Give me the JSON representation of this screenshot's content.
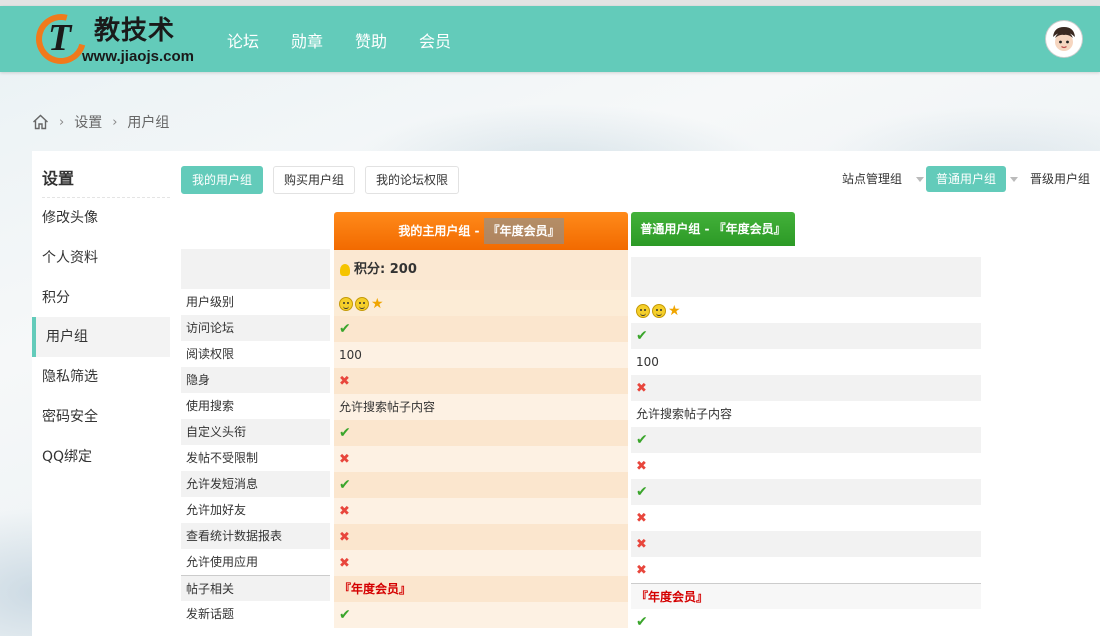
{
  "brand": {
    "logo_letter": "T",
    "name": "教技术",
    "url": "www.jiaojs.com",
    "accent": "#63cbba",
    "orange": "#f07a1c"
  },
  "nav": [
    "论坛",
    "勋章",
    "赞助",
    "会员"
  ],
  "breadcrumb": {
    "items": [
      "设置",
      "用户组"
    ]
  },
  "sidebar": {
    "title": "设置",
    "items": [
      "修改头像",
      "个人资料",
      "积分",
      "用户组",
      "隐私筛选",
      "密码安全",
      "QQ绑定"
    ],
    "active": "用户组"
  },
  "tabs": [
    "我的用户组",
    "购买用户组",
    "我的论坛权限"
  ],
  "right_tabs": [
    "站点管理组",
    "普通用户组",
    "晋级用户组"
  ],
  "columns": {
    "main": {
      "title_prefix": "我的主用户组 - ",
      "title_group": "『年度会员』",
      "score": "积分: 200"
    },
    "normal": {
      "title": "普通用户组 - 『年度会员』"
    }
  },
  "rows": [
    {
      "label": "用户级别",
      "main": "icons",
      "normal": "icons"
    },
    {
      "label": "访问论坛",
      "main": "✔",
      "normal": "✔"
    },
    {
      "label": "阅读权限",
      "main": "100",
      "normal": "100"
    },
    {
      "label": "隐身",
      "main": "✖",
      "normal": "✖"
    },
    {
      "label": "使用搜索",
      "main": "允许搜索帖子内容",
      "normal": "允许搜索帖子内容"
    },
    {
      "label": "自定义头衔",
      "main": "✔",
      "normal": "✔"
    },
    {
      "label": "发帖不受限制",
      "main": "✖",
      "normal": "✖"
    },
    {
      "label": "允许发短消息",
      "main": "✔",
      "normal": "✔"
    },
    {
      "label": "允许加好友",
      "main": "✖",
      "normal": "✖"
    },
    {
      "label": "查看统计数据报表",
      "main": "✖",
      "normal": "✖"
    },
    {
      "label": "允许使用应用",
      "main": "✖",
      "normal": "✖"
    }
  ],
  "section": {
    "label": "帖子相关",
    "main": "『年度会员』",
    "normal": "『年度会员』"
  },
  "section_rows": [
    {
      "label": "发新话题",
      "main": "✔",
      "normal": "✔"
    }
  ]
}
